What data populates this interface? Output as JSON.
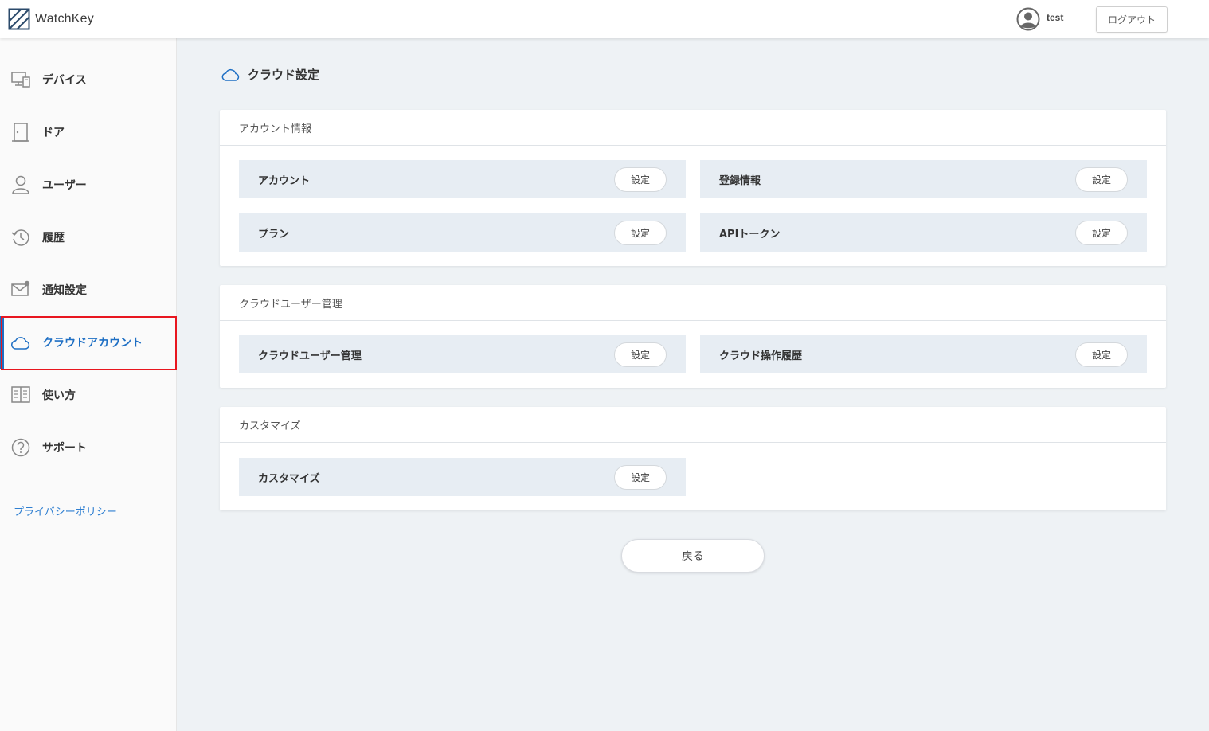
{
  "header": {
    "logo_text": "WatchKey",
    "user_name": "test",
    "logout_label": "ログアウト"
  },
  "sidebar": {
    "items": [
      {
        "label": "デバイス",
        "icon": "monitor-icon"
      },
      {
        "label": "ドア",
        "icon": "door-icon"
      },
      {
        "label": "ユーザー",
        "icon": "user-icon"
      },
      {
        "label": "履歴",
        "icon": "history-icon"
      },
      {
        "label": "通知設定",
        "icon": "mail-icon"
      },
      {
        "label": "クラウドアカウント",
        "icon": "cloud-icon",
        "active": true
      },
      {
        "label": "使い方",
        "icon": "book-icon"
      },
      {
        "label": "サポート",
        "icon": "help-icon"
      }
    ],
    "privacy_link": "プライバシーポリシー",
    "accent_color": "#1e6fc4",
    "highlight_color": "#e8161f"
  },
  "main": {
    "title": "クラウド設定",
    "sections": [
      {
        "heading": "アカウント情報",
        "rows": [
          {
            "label": "アカウント",
            "button": "設定"
          },
          {
            "label": "登録情報",
            "button": "設定"
          },
          {
            "label": "プラン",
            "button": "設定"
          },
          {
            "label": "APIトークン",
            "button": "設定"
          }
        ]
      },
      {
        "heading": "クラウドユーザー管理",
        "rows": [
          {
            "label": "クラウドユーザー管理",
            "button": "設定"
          },
          {
            "label": "クラウド操作履歴",
            "button": "設定"
          }
        ]
      },
      {
        "heading": "カスタマイズ",
        "rows": [
          {
            "label": "カスタマイズ",
            "button": "設定"
          }
        ]
      }
    ],
    "back_label": "戻る"
  }
}
